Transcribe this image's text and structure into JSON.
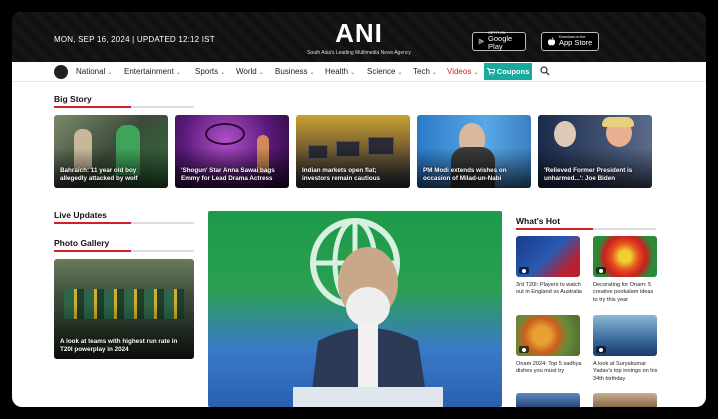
{
  "header": {
    "date": "MON, SEP 16, 2024 | UPDATED 12:12 IST",
    "logo": "ANI",
    "tagline": "South Asia's Leading Multimedia News Agency",
    "google_play_small": "GET IT ON",
    "google_play": "Google Play",
    "app_store_small": "Download on the",
    "app_store": "App Store"
  },
  "nav": {
    "items": [
      "National",
      "Entertainment",
      "Sports",
      "World",
      "Business",
      "Health",
      "Science",
      "Tech",
      "Videos"
    ],
    "coupons": "Coupons"
  },
  "big_story": {
    "title": "Big Story",
    "cards": [
      "Bahraich: 11 year old boy allegedly attacked by wolf",
      "'Shogun' Star Anna Sawai bags Emmy for Lead Drama Actress",
      "Indian markets open flat; investors remain cautious",
      "PM Modi extends wishes on occasion of Milad-un-Nabi",
      "'Relieved Former President is unharmed...': Joe Biden"
    ]
  },
  "live_updates": {
    "title": "Live Updates"
  },
  "photo_gallery": {
    "title": "Photo Gallery",
    "caption": "A look at teams with highest run rate in T20I powerplay in 2024"
  },
  "whats_hot": {
    "title": "What's Hot",
    "items": [
      "3rd T20I: Players to watch out in England vs Australia",
      "Decorating for Onam: 5 creative pookalam ideas to try this year",
      "Onam 2024: Top 5 sadhya dishes you must try",
      "A look at Suryakumar Yadav's top innings on his 34th birthday"
    ]
  }
}
